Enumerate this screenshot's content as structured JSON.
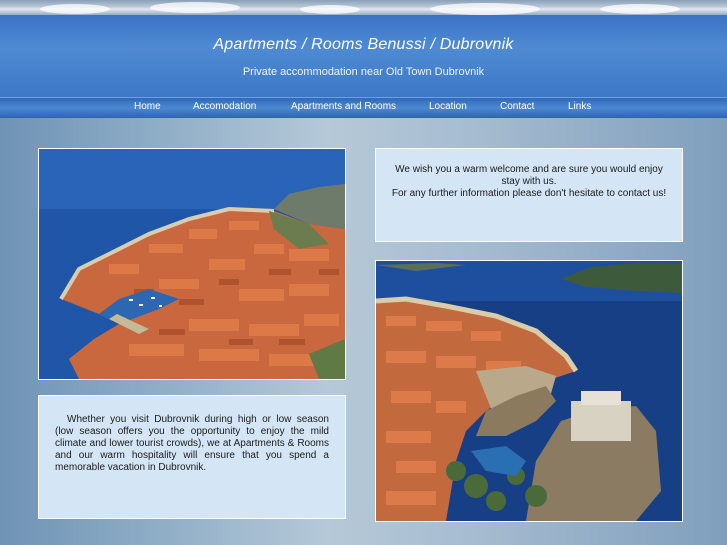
{
  "header": {
    "title": "Apartments / Rooms Benussi / Dubrovnik",
    "subtitle": "Private accommodation near Old Town Dubrovnik"
  },
  "nav": {
    "items": [
      {
        "label": "Home"
      },
      {
        "label": "Accomodation"
      },
      {
        "label": "Apartments and Rooms"
      },
      {
        "label": "Location"
      },
      {
        "label": "Contact"
      },
      {
        "label": "Links"
      }
    ]
  },
  "welcome": {
    "line1": "We wish you a warm welcome and are sure you would enjoy stay with us.",
    "line2": "For any further information please don't hesitate to contact us!"
  },
  "season": {
    "text": "Whether you visit Dubrovnik during high or low season (low season offers you the opportunity to enjoy the mild climate and lower tourist crowds), we at Apartments & Rooms and our warm hospitality will ensure that you spend a memorable vacation in Dubrovnik."
  },
  "colors": {
    "header_blue": "#3d78c6",
    "nav_blue": "#2f6abb",
    "panel": "#d4e6f5",
    "sea": "#1d4c9a"
  },
  "icons": {
    "photo_left": "dubrovnik-old-town-aerial-photo",
    "photo_right": "dubrovnik-city-walls-fortress-photo"
  }
}
